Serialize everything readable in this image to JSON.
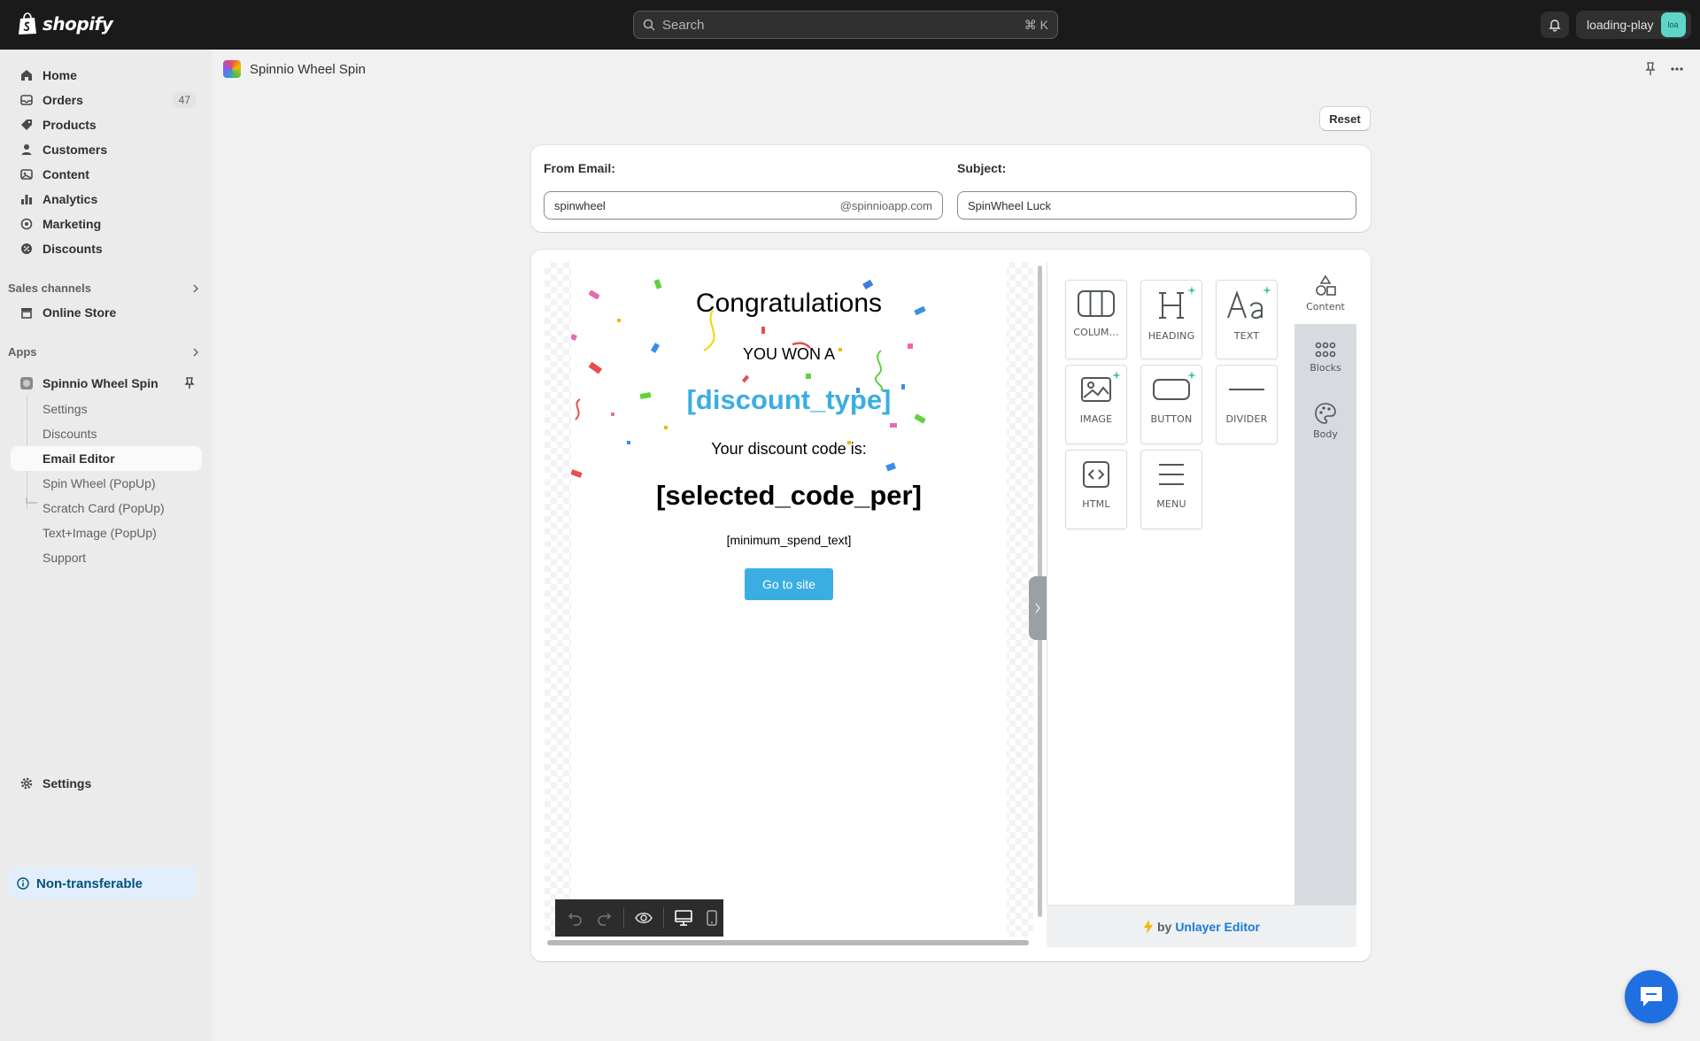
{
  "topbar": {
    "brand": "shopify",
    "search_placeholder": "Search",
    "search_shortcut": "⌘ K",
    "account_name": "loading-play",
    "account_initials": "loa"
  },
  "sidebar": {
    "items": [
      {
        "label": "Home",
        "icon": "home-icon"
      },
      {
        "label": "Orders",
        "icon": "orders-icon",
        "badge": "47"
      },
      {
        "label": "Products",
        "icon": "tag-icon"
      },
      {
        "label": "Customers",
        "icon": "person-icon"
      },
      {
        "label": "Content",
        "icon": "content-icon"
      },
      {
        "label": "Analytics",
        "icon": "bar-chart-icon"
      },
      {
        "label": "Marketing",
        "icon": "target-icon"
      },
      {
        "label": "Discounts",
        "icon": "discount-icon"
      }
    ],
    "sales_channels_label": "Sales channels",
    "online_store": "Online Store",
    "apps_label": "Apps",
    "app_name": "Spinnio Wheel Spin",
    "app_subitems": [
      "Settings",
      "Discounts",
      "Email Editor",
      "Spin Wheel (PopUp)",
      "Scratch Card (PopUp)",
      "Text+Image (PopUp)",
      "Support"
    ],
    "settings": "Settings",
    "non_transferable": "Non-transferable"
  },
  "page": {
    "app_title": "Spinnio Wheel Spin",
    "reset_label": "Reset",
    "from_email_label": "From Email:",
    "from_email_value": "spinwheel",
    "from_email_suffix": "@spinnioapp.com",
    "subject_label": "Subject:",
    "subject_value": "SpinWheel Luck"
  },
  "email": {
    "heading": "Congratulations",
    "won_text": "YOU WON A",
    "discount_type": "[discount_type]",
    "code_intro": "Your discount code is:",
    "code": "[selected_code_per]",
    "minimum_spend": "[minimum_spend_text]",
    "cta": "Go to site"
  },
  "editor": {
    "tools": [
      {
        "label": "COLUM...",
        "icon": "columns-icon"
      },
      {
        "label": "HEADING",
        "icon": "heading-icon",
        "ai": true
      },
      {
        "label": "TEXT",
        "icon": "text-icon",
        "ai": true
      },
      {
        "label": "IMAGE",
        "icon": "image-icon",
        "ai": true
      },
      {
        "label": "BUTTON",
        "icon": "button-icon",
        "ai": true
      },
      {
        "label": "DIVIDER",
        "icon": "divider-icon"
      },
      {
        "label": "HTML",
        "icon": "html-icon"
      },
      {
        "label": "MENU",
        "icon": "menu-icon"
      }
    ],
    "tabs": [
      {
        "label": "Content",
        "icon": "shapes-icon",
        "active": true
      },
      {
        "label": "Blocks",
        "icon": "grid-dots-icon"
      },
      {
        "label": "Body",
        "icon": "palette-icon"
      }
    ],
    "footer_prefix": "by",
    "footer_link": "Unlayer Editor"
  },
  "colors": {
    "accent_blue": "#3aaee0",
    "topbar_bg": "#1a1a1a",
    "chat_blue": "#1f6fe0"
  }
}
